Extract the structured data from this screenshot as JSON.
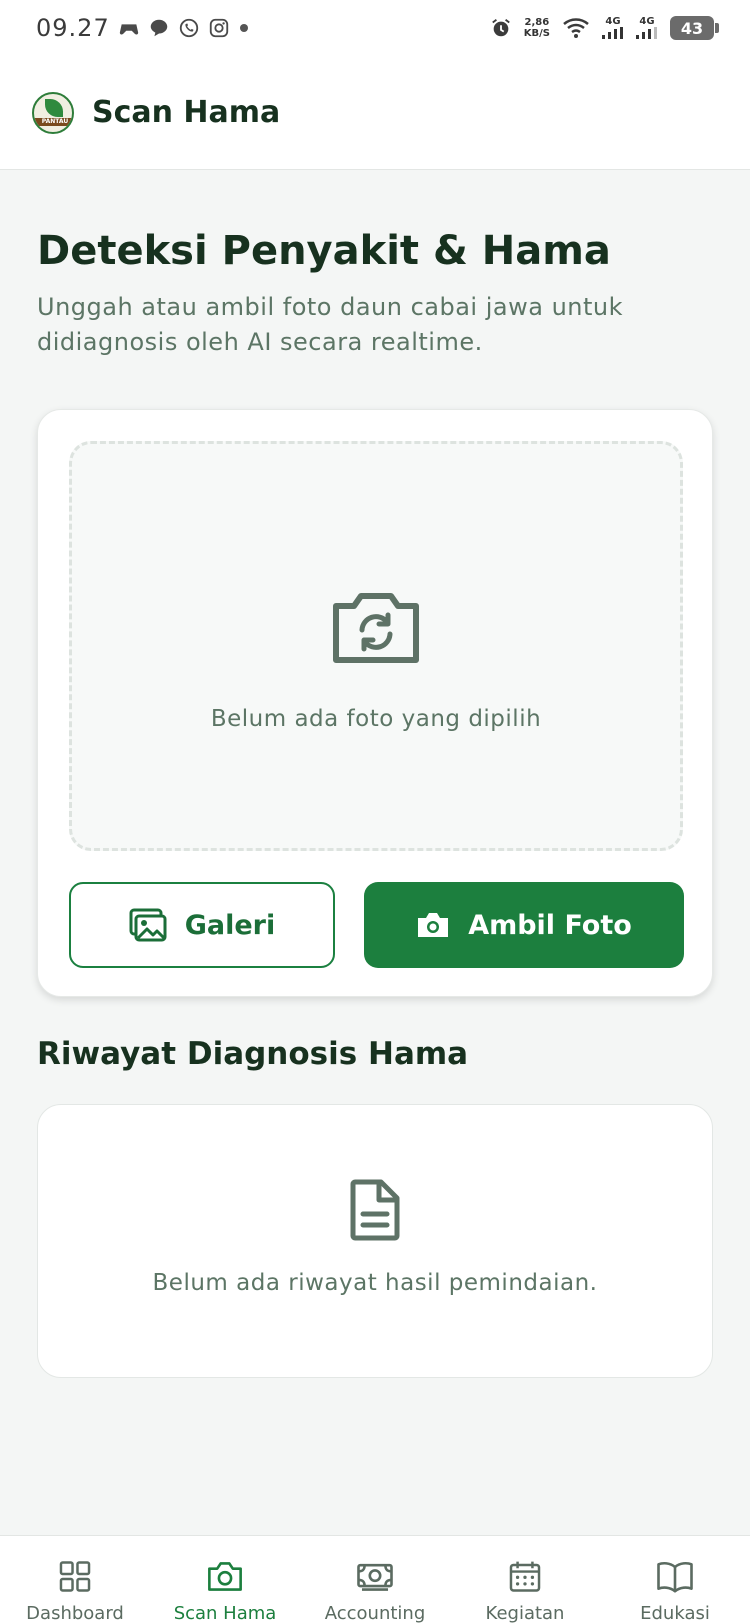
{
  "status_bar": {
    "time": "09.27",
    "net_speed_value": "2,86",
    "net_speed_unit": "KB/S",
    "signal_1": "4G",
    "signal_2": "4G",
    "battery": "43"
  },
  "header": {
    "logo_text": "PANTAU",
    "title": "Scan Hama"
  },
  "intro": {
    "title": "Deteksi Penyakit & Hama",
    "subtitle": "Unggah atau ambil foto daun cabai jawa untuk didiagnosis oleh AI secara realtime."
  },
  "upload": {
    "empty_text": "Belum ada foto yang dipilih",
    "gallery_label": "Galeri",
    "camera_label": "Ambil Foto"
  },
  "history": {
    "title": "Riwayat Diagnosis Hama",
    "empty_text": "Belum ada riwayat hasil pemindaian."
  },
  "nav": {
    "items": [
      {
        "label": "Dashboard",
        "icon": "grid-icon",
        "active": false
      },
      {
        "label": "Scan Hama",
        "icon": "camera-icon",
        "active": true
      },
      {
        "label": "Accounting",
        "icon": "money-icon",
        "active": false
      },
      {
        "label": "Kegiatan",
        "icon": "calendar-icon",
        "active": false
      },
      {
        "label": "Edukasi",
        "icon": "book-icon",
        "active": false
      }
    ]
  },
  "colors": {
    "primary": "#1c7f3e",
    "text_dark": "#17311f",
    "text_muted": "#5c7565",
    "background": "#f4f6f5"
  }
}
